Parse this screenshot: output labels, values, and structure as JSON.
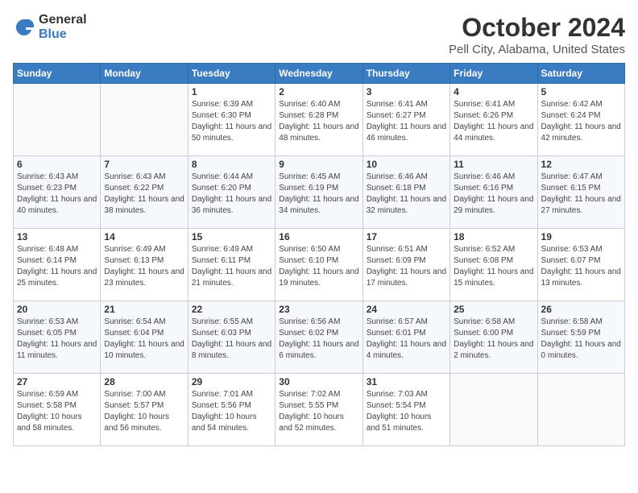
{
  "header": {
    "logo_general": "General",
    "logo_blue": "Blue",
    "title": "October 2024",
    "location": "Pell City, Alabama, United States"
  },
  "days_of_week": [
    "Sunday",
    "Monday",
    "Tuesday",
    "Wednesday",
    "Thursday",
    "Friday",
    "Saturday"
  ],
  "weeks": [
    [
      {
        "day": "",
        "details": ""
      },
      {
        "day": "",
        "details": ""
      },
      {
        "day": "1",
        "details": "Sunrise: 6:39 AM\nSunset: 6:30 PM\nDaylight: 11 hours and 50 minutes."
      },
      {
        "day": "2",
        "details": "Sunrise: 6:40 AM\nSunset: 6:28 PM\nDaylight: 11 hours and 48 minutes."
      },
      {
        "day": "3",
        "details": "Sunrise: 6:41 AM\nSunset: 6:27 PM\nDaylight: 11 hours and 46 minutes."
      },
      {
        "day": "4",
        "details": "Sunrise: 6:41 AM\nSunset: 6:26 PM\nDaylight: 11 hours and 44 minutes."
      },
      {
        "day": "5",
        "details": "Sunrise: 6:42 AM\nSunset: 6:24 PM\nDaylight: 11 hours and 42 minutes."
      }
    ],
    [
      {
        "day": "6",
        "details": "Sunrise: 6:43 AM\nSunset: 6:23 PM\nDaylight: 11 hours and 40 minutes."
      },
      {
        "day": "7",
        "details": "Sunrise: 6:43 AM\nSunset: 6:22 PM\nDaylight: 11 hours and 38 minutes."
      },
      {
        "day": "8",
        "details": "Sunrise: 6:44 AM\nSunset: 6:20 PM\nDaylight: 11 hours and 36 minutes."
      },
      {
        "day": "9",
        "details": "Sunrise: 6:45 AM\nSunset: 6:19 PM\nDaylight: 11 hours and 34 minutes."
      },
      {
        "day": "10",
        "details": "Sunrise: 6:46 AM\nSunset: 6:18 PM\nDaylight: 11 hours and 32 minutes."
      },
      {
        "day": "11",
        "details": "Sunrise: 6:46 AM\nSunset: 6:16 PM\nDaylight: 11 hours and 29 minutes."
      },
      {
        "day": "12",
        "details": "Sunrise: 6:47 AM\nSunset: 6:15 PM\nDaylight: 11 hours and 27 minutes."
      }
    ],
    [
      {
        "day": "13",
        "details": "Sunrise: 6:48 AM\nSunset: 6:14 PM\nDaylight: 11 hours and 25 minutes."
      },
      {
        "day": "14",
        "details": "Sunrise: 6:49 AM\nSunset: 6:13 PM\nDaylight: 11 hours and 23 minutes."
      },
      {
        "day": "15",
        "details": "Sunrise: 6:49 AM\nSunset: 6:11 PM\nDaylight: 11 hours and 21 minutes."
      },
      {
        "day": "16",
        "details": "Sunrise: 6:50 AM\nSunset: 6:10 PM\nDaylight: 11 hours and 19 minutes."
      },
      {
        "day": "17",
        "details": "Sunrise: 6:51 AM\nSunset: 6:09 PM\nDaylight: 11 hours and 17 minutes."
      },
      {
        "day": "18",
        "details": "Sunrise: 6:52 AM\nSunset: 6:08 PM\nDaylight: 11 hours and 15 minutes."
      },
      {
        "day": "19",
        "details": "Sunrise: 6:53 AM\nSunset: 6:07 PM\nDaylight: 11 hours and 13 minutes."
      }
    ],
    [
      {
        "day": "20",
        "details": "Sunrise: 6:53 AM\nSunset: 6:05 PM\nDaylight: 11 hours and 11 minutes."
      },
      {
        "day": "21",
        "details": "Sunrise: 6:54 AM\nSunset: 6:04 PM\nDaylight: 11 hours and 10 minutes."
      },
      {
        "day": "22",
        "details": "Sunrise: 6:55 AM\nSunset: 6:03 PM\nDaylight: 11 hours and 8 minutes."
      },
      {
        "day": "23",
        "details": "Sunrise: 6:56 AM\nSunset: 6:02 PM\nDaylight: 11 hours and 6 minutes."
      },
      {
        "day": "24",
        "details": "Sunrise: 6:57 AM\nSunset: 6:01 PM\nDaylight: 11 hours and 4 minutes."
      },
      {
        "day": "25",
        "details": "Sunrise: 6:58 AM\nSunset: 6:00 PM\nDaylight: 11 hours and 2 minutes."
      },
      {
        "day": "26",
        "details": "Sunrise: 6:58 AM\nSunset: 5:59 PM\nDaylight: 11 hours and 0 minutes."
      }
    ],
    [
      {
        "day": "27",
        "details": "Sunrise: 6:59 AM\nSunset: 5:58 PM\nDaylight: 10 hours and 58 minutes."
      },
      {
        "day": "28",
        "details": "Sunrise: 7:00 AM\nSunset: 5:57 PM\nDaylight: 10 hours and 56 minutes."
      },
      {
        "day": "29",
        "details": "Sunrise: 7:01 AM\nSunset: 5:56 PM\nDaylight: 10 hours and 54 minutes."
      },
      {
        "day": "30",
        "details": "Sunrise: 7:02 AM\nSunset: 5:55 PM\nDaylight: 10 hours and 52 minutes."
      },
      {
        "day": "31",
        "details": "Sunrise: 7:03 AM\nSunset: 5:54 PM\nDaylight: 10 hours and 51 minutes."
      },
      {
        "day": "",
        "details": ""
      },
      {
        "day": "",
        "details": ""
      }
    ]
  ]
}
